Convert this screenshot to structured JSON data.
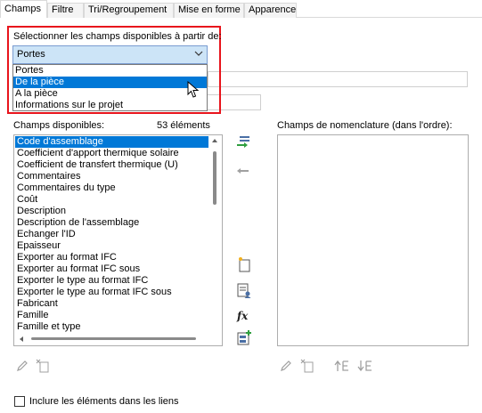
{
  "tabs": [
    {
      "label": "Champs",
      "active": true
    },
    {
      "label": "Filtre",
      "active": false
    },
    {
      "label": "Tri/Regroupement",
      "active": false
    },
    {
      "label": "Mise en forme",
      "active": false
    },
    {
      "label": "Apparence",
      "active": false
    }
  ],
  "source": {
    "label": "Sélectionner les champs disponibles à partir de:",
    "selected": "Portes",
    "options": [
      "Portes",
      "De la pièce",
      "A la pièce",
      "Informations sur le projet"
    ],
    "highlighted_option": "De la pièce"
  },
  "available": {
    "label": "Champs disponibles:",
    "count": "53 éléments",
    "items": [
      "Code d'assemblage",
      "Coefficient d'apport thermique solaire",
      "Coefficient de transfert thermique (U)",
      "Commentaires",
      "Commentaires du type",
      "Coût",
      "Description",
      "Description de l'assemblage",
      "Echanger l'ID",
      "Epaisseur",
      "Exporter au format IFC",
      "Exporter au format IFC sous",
      "Exporter le type au format IFC",
      "Exporter le type au format IFC sous",
      "Fabricant",
      "Famille",
      "Famille et type"
    ],
    "selected_item": "Code d'assemblage"
  },
  "schedule": {
    "label": "Champs de nomenclature (dans l'ordre):",
    "items": []
  },
  "include_links": {
    "label": "Inclure les éléments dans les liens",
    "checked": false
  },
  "colors": {
    "highlight_border": "#e8141c",
    "selection": "#0078d7",
    "combo_bg": "#cce4f7"
  }
}
